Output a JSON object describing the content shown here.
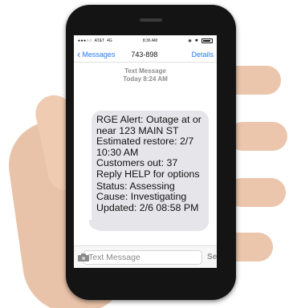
{
  "status_bar": {
    "carrier": "AT&T",
    "network": "4G",
    "time": "8:36 AM"
  },
  "nav": {
    "back_label": "Messages",
    "title": "743-898",
    "details_label": "Details"
  },
  "thread": {
    "header_line1": "Text Message",
    "header_line2": "Today 8:24 AM"
  },
  "message": {
    "lines": [
      "RGE Alert: Outage at or near 123 MAIN ST",
      "Estimated restore: 2/7 10:30 AM",
      "Customers out: 37",
      "Reply HELP for options"
    ],
    "status_lines": [
      "Status: Assessing",
      "Cause: Investigating",
      "Updated: 2/6 08:58 PM"
    ]
  },
  "composer": {
    "placeholder": "Text Message",
    "send_label": "Send"
  },
  "icons": {
    "back": "chevron-left-icon",
    "camera": "camera-icon",
    "battery": "battery-icon",
    "bluetooth": "bluetooth-icon"
  },
  "colors": {
    "accent": "#2a7af5",
    "bubble": "#e6e6ea"
  }
}
